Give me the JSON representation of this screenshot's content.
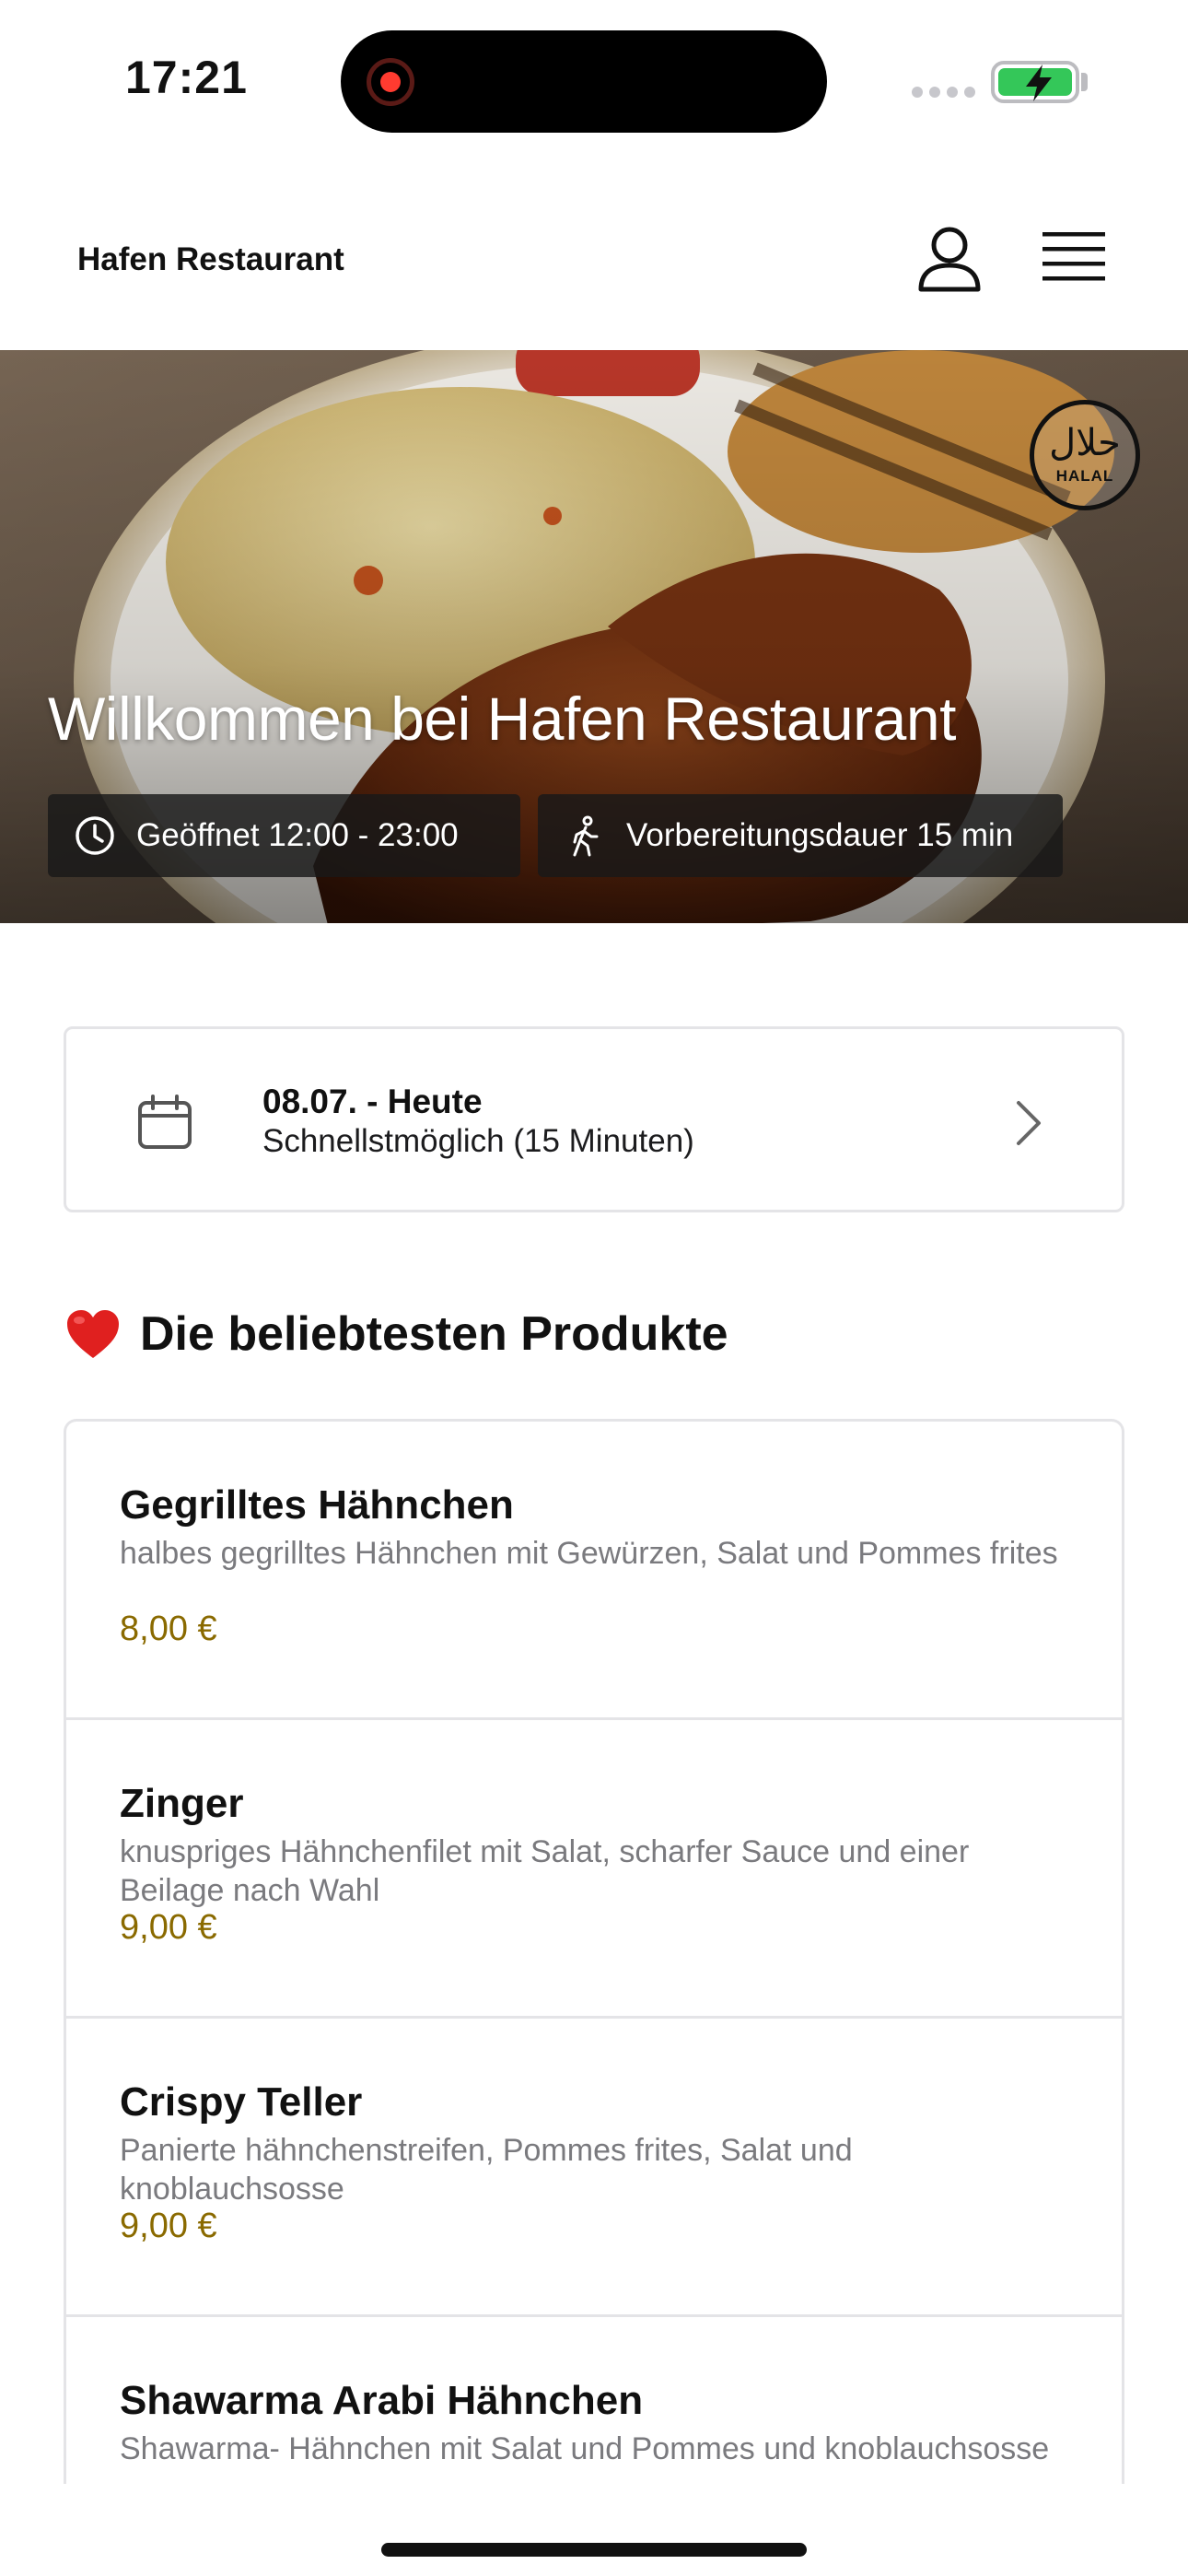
{
  "status_bar": {
    "time": "17:21"
  },
  "header": {
    "title": "Hafen Restaurant"
  },
  "hero": {
    "title": "Willkommen bei Hafen Restaurant",
    "hours": "Geöffnet 12:00 - 23:00",
    "prep_time": "Vorbereitungsdauer 15 min",
    "badge_arabic": "حلال",
    "badge_label": "HALAL"
  },
  "schedule": {
    "date": "08.07. - Heute",
    "time": "Schnellstmöglich (15 Minuten)"
  },
  "popular": {
    "title": "Die beliebtesten Produkte",
    "products": [
      {
        "name": "Gegrilltes Hähnchen",
        "description": "halbes gegrilltes Hähnchen mit Gewürzen, Salat und Pommes frites",
        "price": "8,00 €"
      },
      {
        "name": "Zinger",
        "description": "knuspriges Hähnchenfilet mit Salat, scharfer Sauce und einer Beilage nach Wahl",
        "price": "9,00 €"
      },
      {
        "name": "Crispy Teller",
        "description": "Panierte hähnchenstreifen, Pommes frites, Salat und knoblauchsosse",
        "price": "9,00 €"
      },
      {
        "name": "Shawarma Arabi Hähnchen",
        "description": "Shawarma- Hähnchen mit Salat und Pommes und knoblauchsosse",
        "price": ""
      }
    ]
  },
  "colors": {
    "price": "#8a6a00",
    "border": "#e4e4e7",
    "battery": "#34c759",
    "record": "#ff3b30"
  }
}
